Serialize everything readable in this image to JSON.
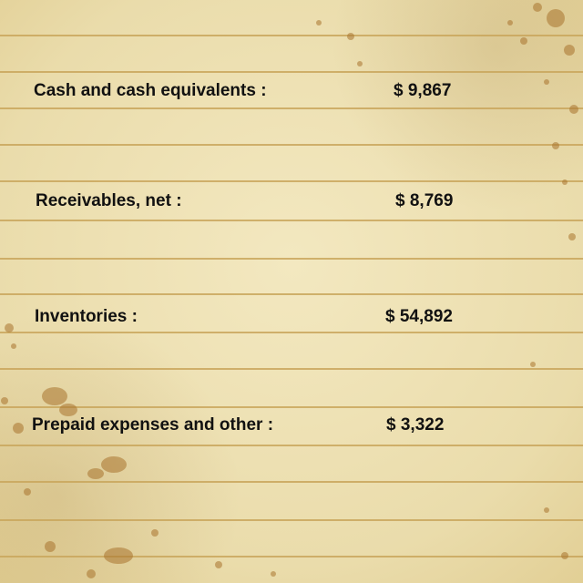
{
  "rows": [
    {
      "label": "Cash and cash equivalents :",
      "value": "$ 9,867"
    },
    {
      "label": "Receivables, net :",
      "value": "$ 8,769"
    },
    {
      "label": "Inventories :",
      "value": "$ 54,892"
    },
    {
      "label": "Prepaid expenses and other :",
      "value": "$ 3,322"
    }
  ],
  "colors": {
    "paper": "#efe2b4",
    "rule": "#c9a65c",
    "stain": "#a9742e",
    "text": "#111111"
  }
}
